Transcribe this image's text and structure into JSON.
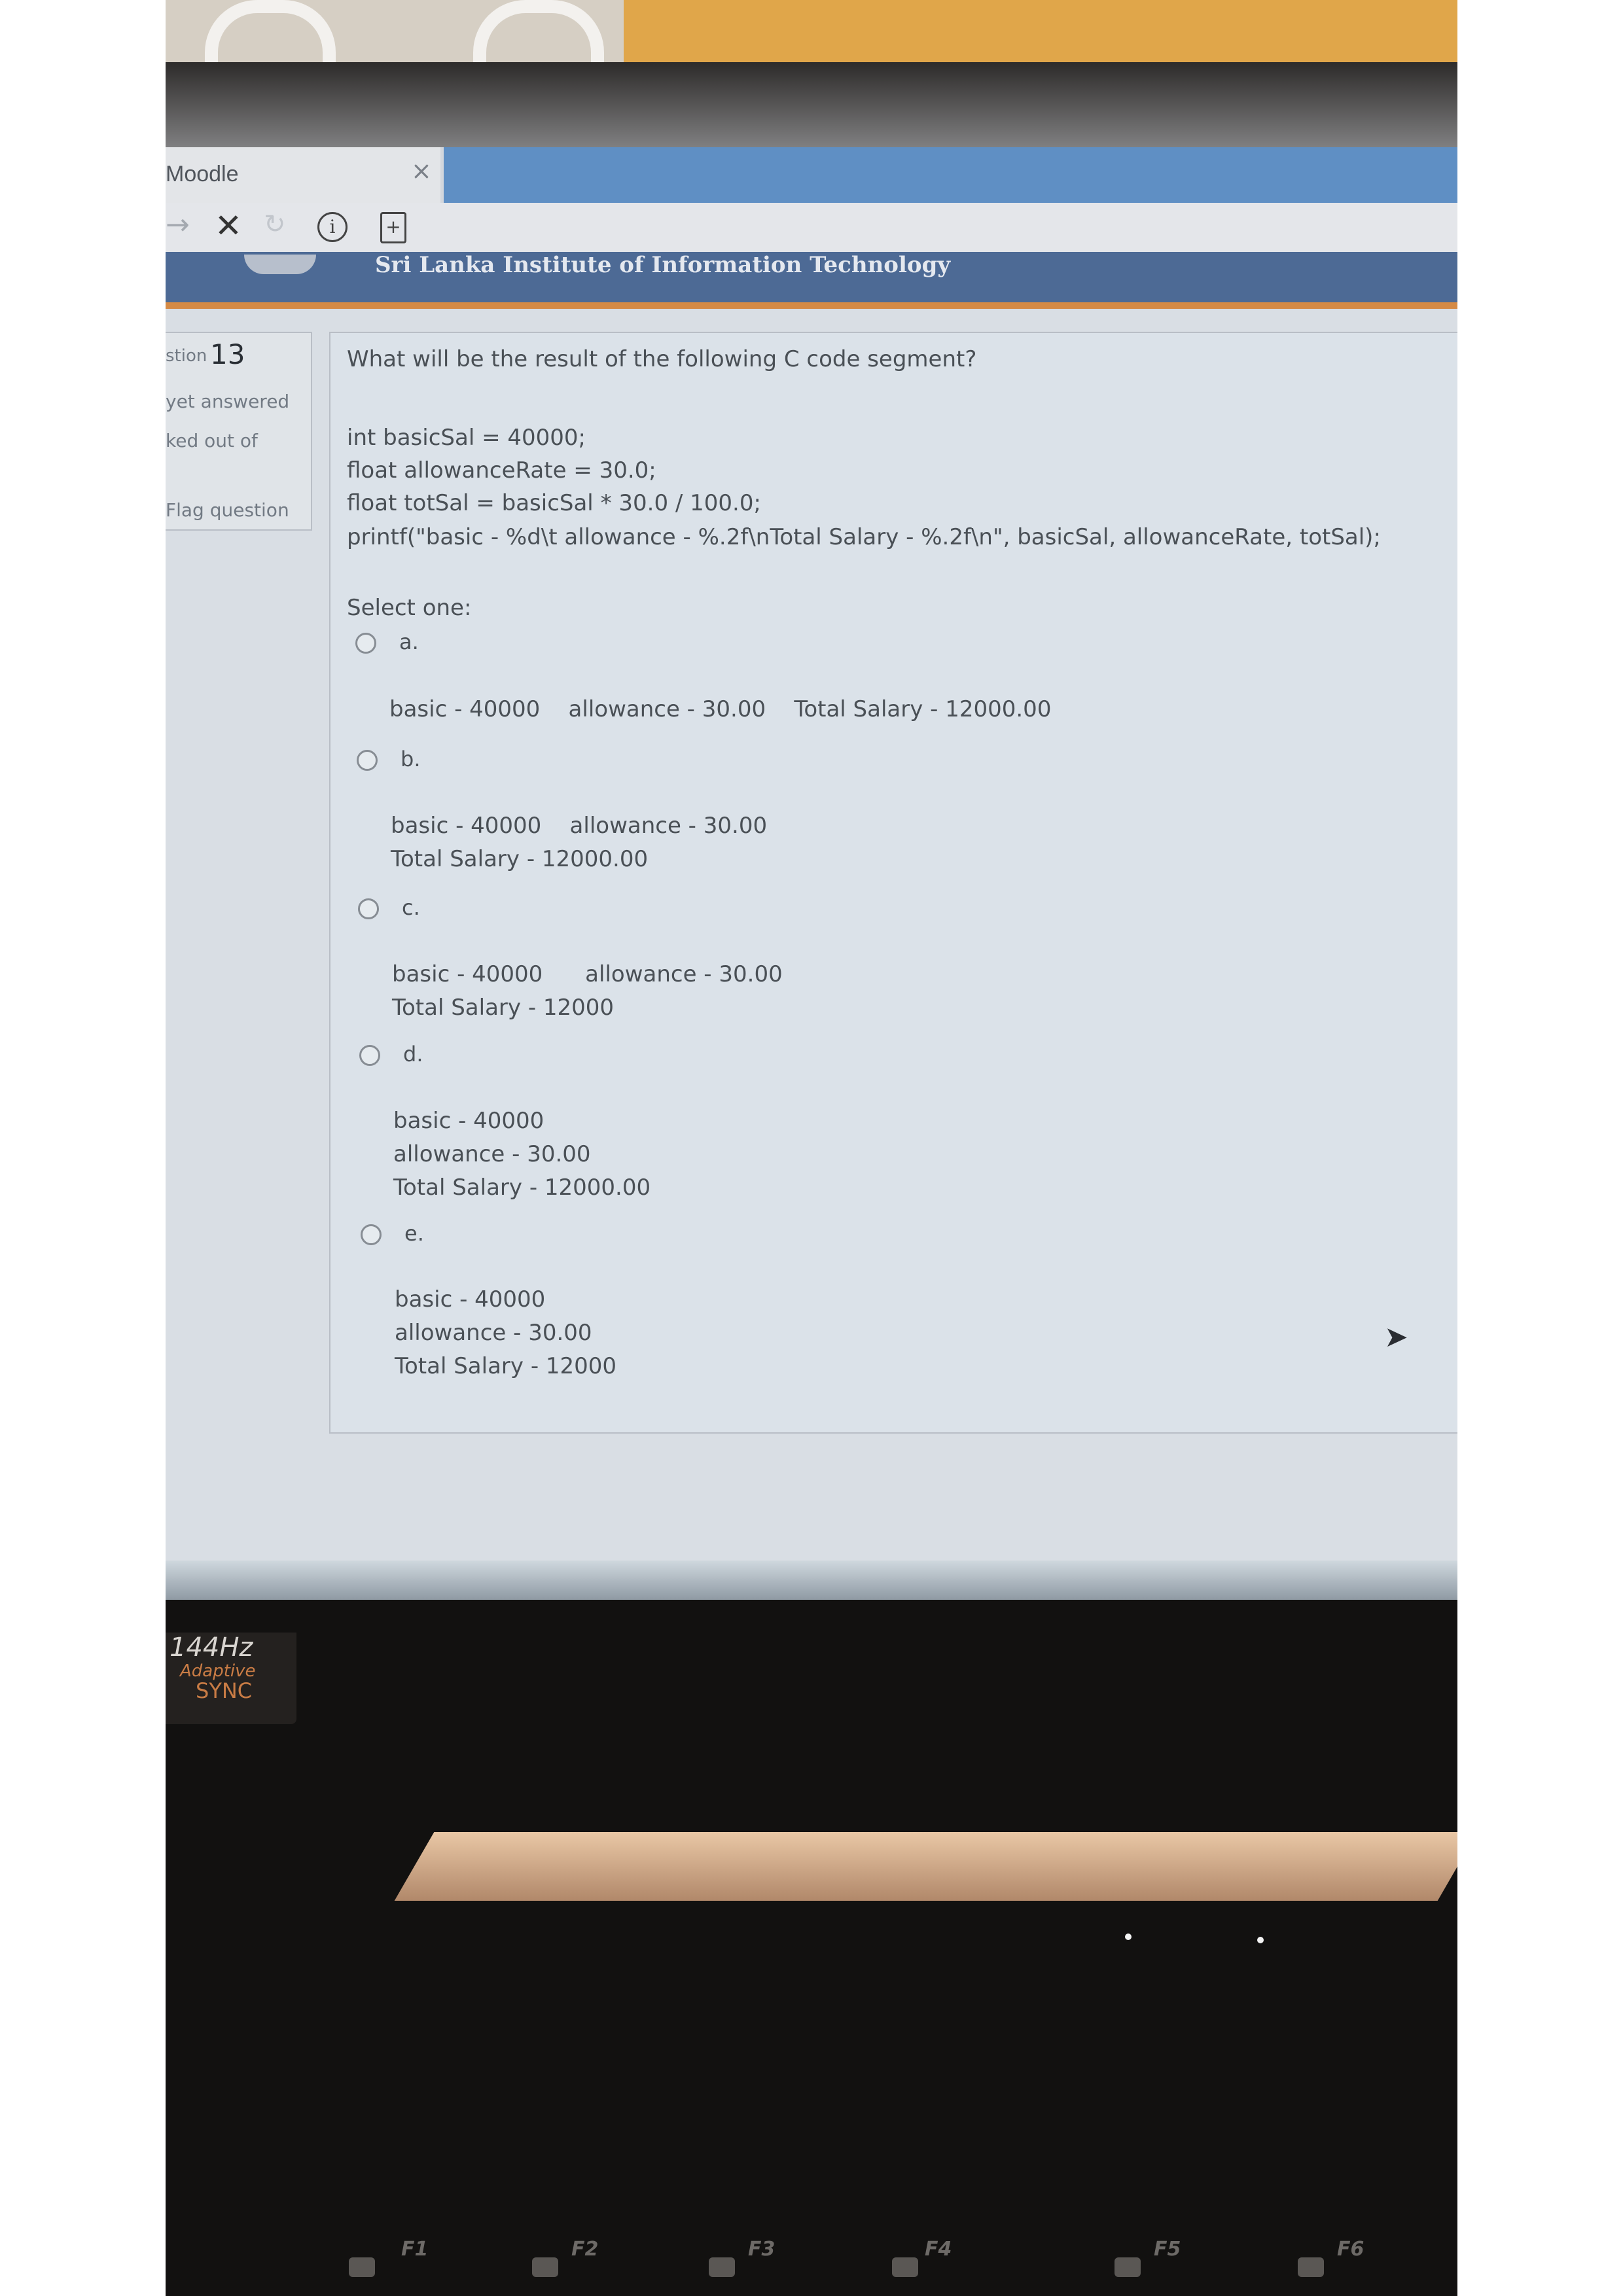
{
  "browser": {
    "tab_title": "Moodle",
    "tab_close": "×",
    "nav_back": "→",
    "nav_stop": "✕",
    "nav_reload": "↻",
    "nav_info": "i",
    "nav_page": "+"
  },
  "site": {
    "title": "Sri Lanka Institute of Information Technology"
  },
  "question_info": {
    "number_label": "stion",
    "number": "13",
    "status": "yet answered",
    "marked": "ked out of",
    "flag": "Flag question"
  },
  "question": {
    "prompt": "What will be the result of the following C code segment?",
    "code": [
      "int basicSal = 40000;",
      "float allowanceRate = 30.0;",
      "float totSal = basicSal * 30.0 / 100.0;",
      "printf(\"basic - %d\\t allowance - %.2f\\nTotal Salary - %.2f\\n\", basicSal, allowanceRate, totSal);"
    ],
    "select_label": "Select one:",
    "options": [
      {
        "letter": "a.",
        "lines": [
          "basic - 40000    allowance - 30.00    Total Salary - 12000.00"
        ]
      },
      {
        "letter": "b.",
        "lines": [
          "basic - 40000    allowance - 30.00",
          "Total Salary - 12000.00"
        ]
      },
      {
        "letter": "c.",
        "lines": [
          "basic - 40000      allowance - 30.00",
          "Total Salary - 12000"
        ]
      },
      {
        "letter": "d.",
        "lines": [
          "basic - 40000",
          "allowance - 30.00",
          "Total Salary - 12000.00"
        ]
      },
      {
        "letter": "e.",
        "lines": [
          "basic - 40000",
          "allowance - 30.00",
          "Total Salary - 12000"
        ]
      }
    ]
  },
  "laptop": {
    "badge_hz": "144Hz",
    "badge_adaptive": "Adaptive",
    "badge_sync": "SYNC",
    "fkeys": [
      "F1",
      "F2",
      "F3",
      "F4",
      "F5",
      "F6"
    ]
  },
  "icons": {
    "cursor": "mouse-cursor-icon",
    "reload": "reload-icon",
    "info": "info-icon",
    "page": "page-action-icon"
  }
}
